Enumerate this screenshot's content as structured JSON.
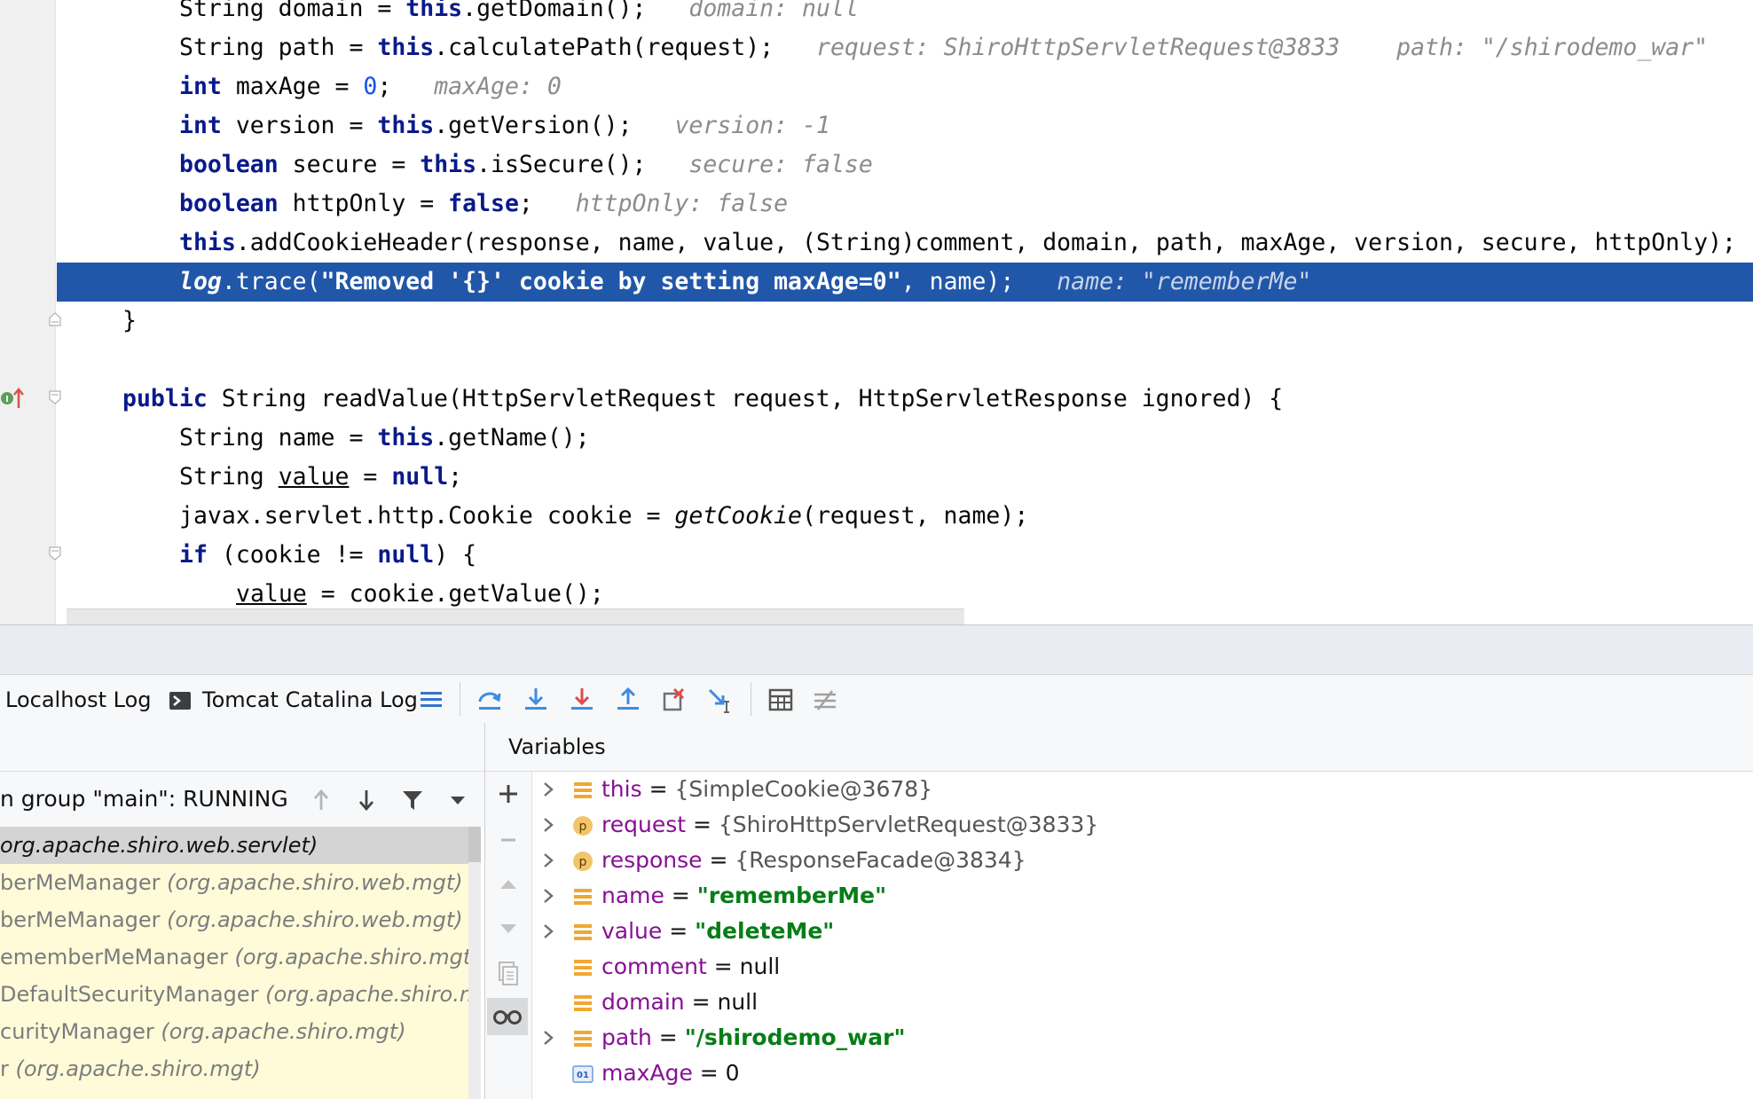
{
  "editor": {
    "lines": [
      {
        "indent": 2,
        "parts": [
          {
            "t": "String domain = "
          },
          {
            "t": "this",
            "c": "kw"
          },
          {
            "t": ".getDomain();   "
          },
          {
            "t": "domain: null",
            "c": "hint"
          }
        ]
      },
      {
        "indent": 2,
        "parts": [
          {
            "t": "String path = "
          },
          {
            "t": "this",
            "c": "kw"
          },
          {
            "t": ".calculatePath(request);   "
          },
          {
            "t": "request: ShiroHttpServletRequest@3833    path: \"/shirodemo_war\"",
            "c": "hint"
          }
        ]
      },
      {
        "indent": 2,
        "parts": [
          {
            "t": "int",
            "c": "kw"
          },
          {
            "t": " maxAge = "
          },
          {
            "t": "0",
            "c": "num"
          },
          {
            "t": ";   "
          },
          {
            "t": "maxAge: 0",
            "c": "hint"
          }
        ]
      },
      {
        "indent": 2,
        "parts": [
          {
            "t": "int",
            "c": "kw"
          },
          {
            "t": " version = "
          },
          {
            "t": "this",
            "c": "kw"
          },
          {
            "t": ".getVersion();   "
          },
          {
            "t": "version: -1",
            "c": "hint"
          }
        ]
      },
      {
        "indent": 2,
        "parts": [
          {
            "t": "boolean",
            "c": "kw"
          },
          {
            "t": " secure = "
          },
          {
            "t": "this",
            "c": "kw"
          },
          {
            "t": ".isSecure();   "
          },
          {
            "t": "secure: false",
            "c": "hint"
          }
        ]
      },
      {
        "indent": 2,
        "parts": [
          {
            "t": "boolean",
            "c": "kw"
          },
          {
            "t": " httpOnly = "
          },
          {
            "t": "false",
            "c": "kw"
          },
          {
            "t": ";   "
          },
          {
            "t": "httpOnly: false",
            "c": "hint"
          }
        ]
      },
      {
        "indent": 2,
        "parts": [
          {
            "t": "this",
            "c": "kw"
          },
          {
            "t": ".addCookieHeader(response, name, value, (String)comment, domain, path, maxAge, version, secure, httpOnly);"
          }
        ]
      },
      {
        "indent": 2,
        "current": true,
        "parts": [
          {
            "t": "log",
            "c": "kw it"
          },
          {
            "t": ".trace("
          },
          {
            "t": "\"Removed '{}' cookie by setting maxAge=0\"",
            "c": "cstr"
          },
          {
            "t": ", name);   "
          },
          {
            "t": "name: \"rememberMe\"",
            "c": "hint"
          }
        ]
      },
      {
        "indent": 1,
        "parts": [
          {
            "t": "}"
          }
        ]
      },
      {
        "indent": 1,
        "parts": [
          {
            "t": ""
          }
        ]
      },
      {
        "indent": 1,
        "parts": [
          {
            "t": "public",
            "c": "kw"
          },
          {
            "t": " String readValue(HttpServletRequest request, HttpServletResponse ignored) {"
          }
        ]
      },
      {
        "indent": 2,
        "parts": [
          {
            "t": "String name = "
          },
          {
            "t": "this",
            "c": "kw"
          },
          {
            "t": ".getName();"
          }
        ]
      },
      {
        "indent": 2,
        "parts": [
          {
            "t": "String "
          },
          {
            "t": "value",
            "c": "ul"
          },
          {
            "t": " = "
          },
          {
            "t": "null",
            "c": "kw"
          },
          {
            "t": ";"
          }
        ]
      },
      {
        "indent": 2,
        "parts": [
          {
            "t": "javax.servlet.http.Cookie cookie = "
          },
          {
            "t": "getCookie",
            "c": "it"
          },
          {
            "t": "(request, name);"
          }
        ]
      },
      {
        "indent": 2,
        "parts": [
          {
            "t": "if",
            "c": "kw"
          },
          {
            "t": " (cookie != "
          },
          {
            "t": "null",
            "c": "kw"
          },
          {
            "t": ") {"
          }
        ]
      },
      {
        "indent": 3,
        "parts": [
          {
            "t": "value",
            "c": "ul"
          },
          {
            "t": " = cookie.getValue();"
          }
        ]
      }
    ]
  },
  "toolbar": {
    "localhost_log": "Localhost Log",
    "catalina_log": "Tomcat Catalina Log"
  },
  "frames": {
    "thread": "n group \"main\": RUNNING",
    "items": [
      {
        "cls": "",
        "pkg": "org.apache.shiro.web.servlet)",
        "selected": true
      },
      {
        "cls": "berMeManager ",
        "pkg": "(org.apache.shiro.web.mgt)"
      },
      {
        "cls": "berMeManager ",
        "pkg": "(org.apache.shiro.web.mgt)"
      },
      {
        "cls": "ememberMeManager ",
        "pkg": "(org.apache.shiro.mgt)"
      },
      {
        "cls": " DefaultSecurityManager ",
        "pkg": "(org.apache.shiro.mgt)"
      },
      {
        "cls": "curityManager ",
        "pkg": "(org.apache.shiro.mgt)"
      },
      {
        "cls": "r ",
        "pkg": "(org.apache.shiro.mgt)"
      }
    ]
  },
  "variables": {
    "title": "Variables",
    "items": [
      {
        "name": "this",
        "value": "{SimpleCookie@3678}",
        "kind": "field",
        "vtype": "obj",
        "expandable": true
      },
      {
        "name": "request",
        "value": "{ShiroHttpServletRequest@3833}",
        "kind": "param",
        "vtype": "obj",
        "expandable": true
      },
      {
        "name": "response",
        "value": "{ResponseFacade@3834}",
        "kind": "param",
        "vtype": "obj",
        "expandable": true
      },
      {
        "name": "name",
        "value": "\"rememberMe\"",
        "kind": "field",
        "vtype": "str",
        "expandable": true
      },
      {
        "name": "value",
        "value": "\"deleteMe\"",
        "kind": "field",
        "vtype": "str",
        "expandable": true
      },
      {
        "name": "comment",
        "value": "null",
        "kind": "field",
        "vtype": "plain",
        "expandable": false
      },
      {
        "name": "domain",
        "value": "null",
        "kind": "field",
        "vtype": "plain",
        "expandable": false
      },
      {
        "name": "path",
        "value": "\"/shirodemo_war\"",
        "kind": "field",
        "vtype": "str",
        "expandable": true
      },
      {
        "name": "maxAge",
        "value": "0",
        "kind": "int",
        "vtype": "plain",
        "expandable": false
      }
    ]
  },
  "colors": {
    "current_line": "#2157a8",
    "keyword": "#0a1a8a",
    "string": "#067d17",
    "frames_bg": "#fffbd9"
  }
}
